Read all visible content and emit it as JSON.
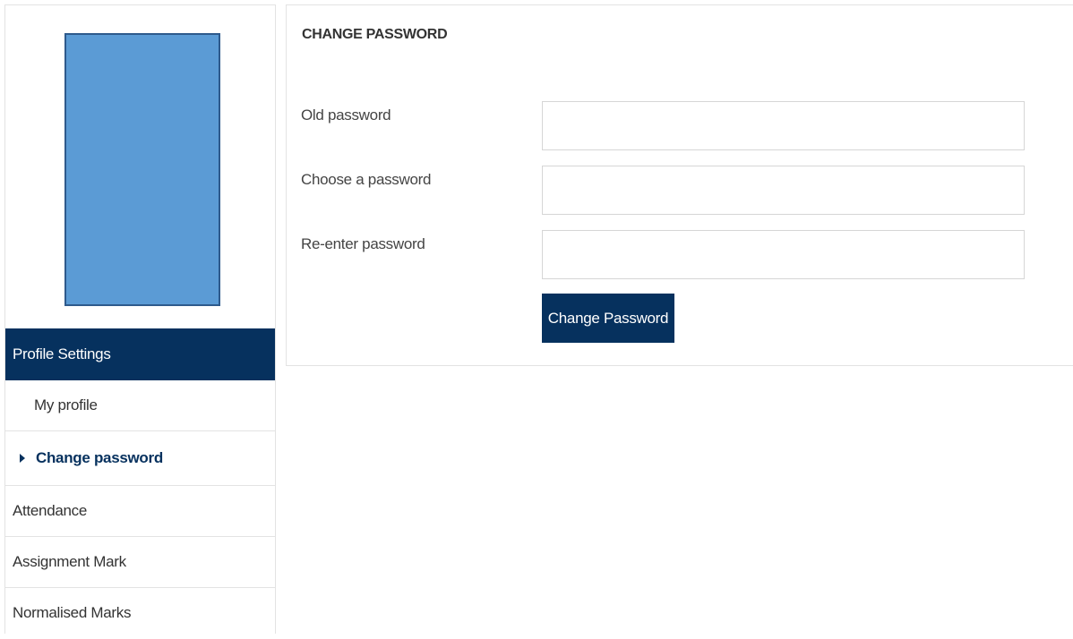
{
  "sidebar": {
    "header": "Profile Settings",
    "items": [
      {
        "label": "My profile"
      },
      {
        "label": "Change password"
      },
      {
        "label": "Attendance"
      },
      {
        "label": "Assignment Mark"
      },
      {
        "label": "Normalised Marks"
      }
    ]
  },
  "panel": {
    "title": "CHANGE PASSWORD",
    "fields": [
      {
        "label": "Old password",
        "value": "",
        "placeholder": ""
      },
      {
        "label": "Choose a password",
        "value": "",
        "placeholder": ""
      },
      {
        "label": "Re-enter password",
        "value": "",
        "placeholder": ""
      }
    ],
    "submit_label": "Change Password"
  },
  "colors": {
    "primary": "#06315e",
    "avatar_fill": "#5b9bd5",
    "border": "#e3e3e3"
  },
  "icons": {
    "active_marker": "caret-right-icon"
  }
}
